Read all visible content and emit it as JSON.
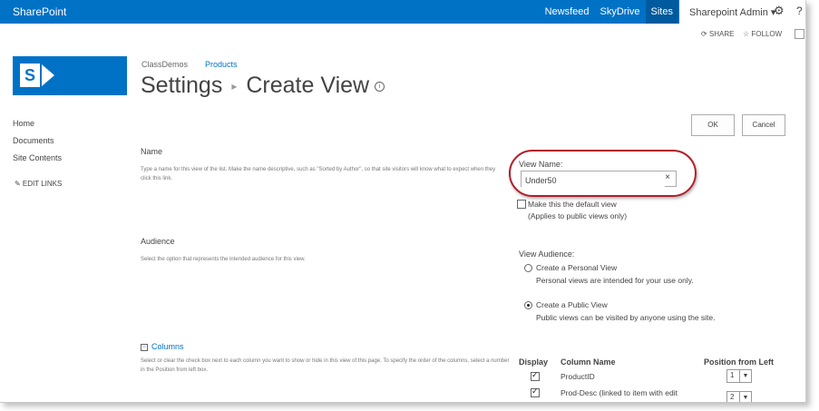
{
  "suitebar": {
    "brand": "SharePoint",
    "nav": [
      "Newsfeed",
      "SkyDrive",
      "Sites"
    ],
    "user": "Sharepoint Admin ▾",
    "gear": "⚙",
    "help": "?",
    "color": "#0072c6"
  },
  "actions": {
    "share": "SHARE",
    "follow": "FOLLOW"
  },
  "breadcrumb": {
    "site": "ClassDemos",
    "list": "Products"
  },
  "title": {
    "settings": "Settings",
    "sep": "▸",
    "page": "Create View",
    "info": "i"
  },
  "leftnav": {
    "items": [
      "Home",
      "Documents",
      "Site Contents"
    ],
    "edit": "✎  EDIT LINKS"
  },
  "buttons": {
    "ok": "OK",
    "cancel": "Cancel"
  },
  "name_section": {
    "title": "Name",
    "desc": "Type a name for this view of the list. Make the name descriptive, such as \"Sorted by Author\", so that site visitors will know what to expect when they click this link.",
    "label": "View Name:",
    "value": "Under50",
    "clear": "×",
    "default_label": "Make this the default view",
    "default_note": "(Applies to public views only)"
  },
  "audience_section": {
    "title": "Audience",
    "desc": "Select the option that represents the intended audience for this view.",
    "label": "View Audience:",
    "personal": "Create a Personal View",
    "personal_desc": "Personal views are intended for your use only.",
    "public": "Create a Public View",
    "public_desc": "Public views can be visited by anyone using the site."
  },
  "columns_section": {
    "title": "Columns",
    "collapse": "−",
    "desc": "Select or clear the check box next to each column you want to show or hide in this view of this page. To specify the order of the columns, select a number in the Position from left box.",
    "headers": {
      "display": "Display",
      "name": "Column Name",
      "position": "Position from Left"
    },
    "rows": [
      {
        "name": "ProductID",
        "position": "1"
      },
      {
        "name": "Prod-Desc (linked to item with edit",
        "position": "2"
      }
    ]
  }
}
